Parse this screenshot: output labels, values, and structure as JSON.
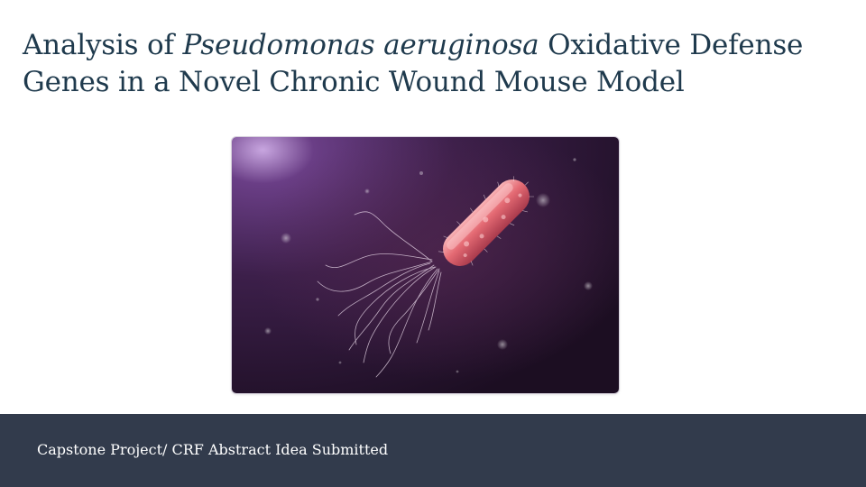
{
  "title": {
    "part1": "Analysis of ",
    "italic": "Pseudomonas aeruginosa",
    "part2": " Oxidative Defense Genes in a Novel Chronic Wound Mouse Model"
  },
  "figure": {
    "icon": "bacterium-illustration",
    "colors": {
      "background_dark": "#1e0f26",
      "background_glow": "#7a4a8c",
      "cell_body": "#e0606a",
      "cell_highlight": "#f6a2a6",
      "flagella": "#e8d8e8"
    }
  },
  "footer": {
    "text": "Capstone Project/ CRF Abstract Idea Submitted",
    "background": "#323b4c"
  }
}
